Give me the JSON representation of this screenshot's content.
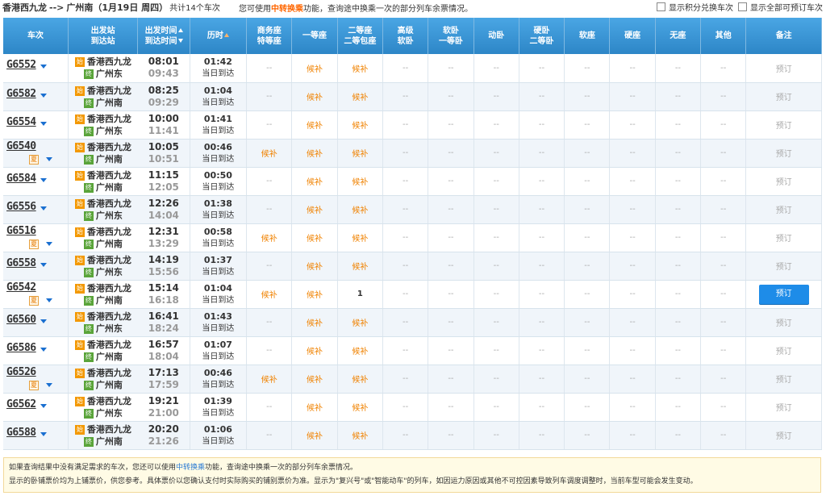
{
  "header": {
    "from": "香港西九龙",
    "arrow": "-->",
    "to": "广州南",
    "date": "（1月19日 周四）",
    "count": "共计14个车次",
    "hint_pre": "您可使用",
    "hint_link": "中转换乘",
    "hint_post": "功能，查询途中换乘一次的部分列车余票情况。",
    "opt_points": "显示积分兑换车次",
    "opt_all": "显示全部可预订车次"
  },
  "columns": {
    "train": "车次",
    "station_1": "出发站",
    "station_2": "到达站",
    "time_1": "出发时间",
    "time_2": "到达时间",
    "duration": "历时",
    "business_1": "商务座",
    "business_2": "特等座",
    "first": "一等座",
    "second_1": "二等座",
    "second_2": "二等包座",
    "soft_sleeper_hi_1": "高级",
    "soft_sleeper_hi_2": "软卧",
    "soft_sleeper_1_1": "软卧",
    "soft_sleeper_1_2": "一等卧",
    "moving_sleeper": "动卧",
    "hard_sleeper_1": "硬卧",
    "hard_sleeper_2": "二等卧",
    "soft_seat": "软座",
    "hard_seat": "硬座",
    "no_seat": "无座",
    "other": "其他",
    "remark": "备注"
  },
  "labels": {
    "start_icon": "始",
    "end_icon": "终",
    "xia_icon": "夏",
    "same_day": "当日到达",
    "dash": "--",
    "hb": "候补",
    "book": "预订"
  },
  "trains": [
    {
      "no": "G6552",
      "xia": false,
      "from": "香港西九龙",
      "to": "广州东",
      "dep": "08:01",
      "arr": "09:43",
      "dur": "01:42",
      "seats": [
        "--",
        "候补",
        "候补",
        "--",
        "--",
        "--",
        "--",
        "--",
        "--",
        "--",
        "--"
      ],
      "book_active": false
    },
    {
      "no": "G6582",
      "xia": false,
      "from": "香港西九龙",
      "to": "广州南",
      "dep": "08:25",
      "arr": "09:29",
      "dur": "01:04",
      "seats": [
        "--",
        "候补",
        "候补",
        "--",
        "--",
        "--",
        "--",
        "--",
        "--",
        "--",
        "--"
      ],
      "book_active": false
    },
    {
      "no": "G6554",
      "xia": false,
      "from": "香港西九龙",
      "to": "广州东",
      "dep": "10:00",
      "arr": "11:41",
      "dur": "01:41",
      "seats": [
        "--",
        "候补",
        "候补",
        "--",
        "--",
        "--",
        "--",
        "--",
        "--",
        "--",
        "--"
      ],
      "book_active": false
    },
    {
      "no": "G6540",
      "xia": true,
      "from": "香港西九龙",
      "to": "广州南",
      "dep": "10:05",
      "arr": "10:51",
      "dur": "00:46",
      "seats": [
        "候补",
        "候补",
        "候补",
        "--",
        "--",
        "--",
        "--",
        "--",
        "--",
        "--",
        "--"
      ],
      "book_active": false
    },
    {
      "no": "G6584",
      "xia": false,
      "from": "香港西九龙",
      "to": "广州南",
      "dep": "11:15",
      "arr": "12:05",
      "dur": "00:50",
      "seats": [
        "--",
        "候补",
        "候补",
        "--",
        "--",
        "--",
        "--",
        "--",
        "--",
        "--",
        "--"
      ],
      "book_active": false
    },
    {
      "no": "G6556",
      "xia": false,
      "from": "香港西九龙",
      "to": "广州东",
      "dep": "12:26",
      "arr": "14:04",
      "dur": "01:38",
      "seats": [
        "--",
        "候补",
        "候补",
        "--",
        "--",
        "--",
        "--",
        "--",
        "--",
        "--",
        "--"
      ],
      "book_active": false
    },
    {
      "no": "G6516",
      "xia": true,
      "from": "香港西九龙",
      "to": "广州南",
      "dep": "12:31",
      "arr": "13:29",
      "dur": "00:58",
      "seats": [
        "候补",
        "候补",
        "候补",
        "--",
        "--",
        "--",
        "--",
        "--",
        "--",
        "--",
        "--"
      ],
      "book_active": false
    },
    {
      "no": "G6558",
      "xia": false,
      "from": "香港西九龙",
      "to": "广州东",
      "dep": "14:19",
      "arr": "15:56",
      "dur": "01:37",
      "seats": [
        "--",
        "候补",
        "候补",
        "--",
        "--",
        "--",
        "--",
        "--",
        "--",
        "--",
        "--"
      ],
      "book_active": false
    },
    {
      "no": "G6542",
      "xia": true,
      "from": "香港西九龙",
      "to": "广州南",
      "dep": "15:14",
      "arr": "16:18",
      "dur": "01:04",
      "seats": [
        "候补",
        "候补",
        "1",
        "--",
        "--",
        "--",
        "--",
        "--",
        "--",
        "--",
        "--"
      ],
      "book_active": true
    },
    {
      "no": "G6560",
      "xia": false,
      "from": "香港西九龙",
      "to": "广州东",
      "dep": "16:41",
      "arr": "18:24",
      "dur": "01:43",
      "seats": [
        "--",
        "候补",
        "候补",
        "--",
        "--",
        "--",
        "--",
        "--",
        "--",
        "--",
        "--"
      ],
      "book_active": false
    },
    {
      "no": "G6586",
      "xia": false,
      "from": "香港西九龙",
      "to": "广州南",
      "dep": "16:57",
      "arr": "18:04",
      "dur": "01:07",
      "seats": [
        "--",
        "候补",
        "候补",
        "--",
        "--",
        "--",
        "--",
        "--",
        "--",
        "--",
        "--"
      ],
      "book_active": false
    },
    {
      "no": "G6526",
      "xia": true,
      "from": "香港西九龙",
      "to": "广州南",
      "dep": "17:13",
      "arr": "17:59",
      "dur": "00:46",
      "seats": [
        "候补",
        "候补",
        "候补",
        "--",
        "--",
        "--",
        "--",
        "--",
        "--",
        "--",
        "--"
      ],
      "book_active": false
    },
    {
      "no": "G6562",
      "xia": false,
      "from": "香港西九龙",
      "to": "广州东",
      "dep": "19:21",
      "arr": "21:00",
      "dur": "01:39",
      "seats": [
        "--",
        "候补",
        "候补",
        "--",
        "--",
        "--",
        "--",
        "--",
        "--",
        "--",
        "--"
      ],
      "book_active": false
    },
    {
      "no": "G6588",
      "xia": false,
      "from": "香港西九龙",
      "to": "广州南",
      "dep": "20:20",
      "arr": "21:26",
      "dur": "01:06",
      "seats": [
        "--",
        "候补",
        "候补",
        "--",
        "--",
        "--",
        "--",
        "--",
        "--",
        "--",
        "--"
      ],
      "book_active": false
    }
  ],
  "notice": {
    "line1_pre": "如果查询结果中没有满足需求的车次，您还可以使用",
    "line1_link": "中转换乘",
    "line1_post": "功能，查询途中换乘一次的部分列车余票情况。",
    "line2": "显示的卧铺票价均为上铺票价，供您参考。具体票价以您确认支付时实际购买的铺别票价为准。显示为\"复兴号\"或\"智能动车\"的列车，如因运力原因或其他不可控因素导致列车调度调整时，当前车型可能会发生变动。"
  }
}
